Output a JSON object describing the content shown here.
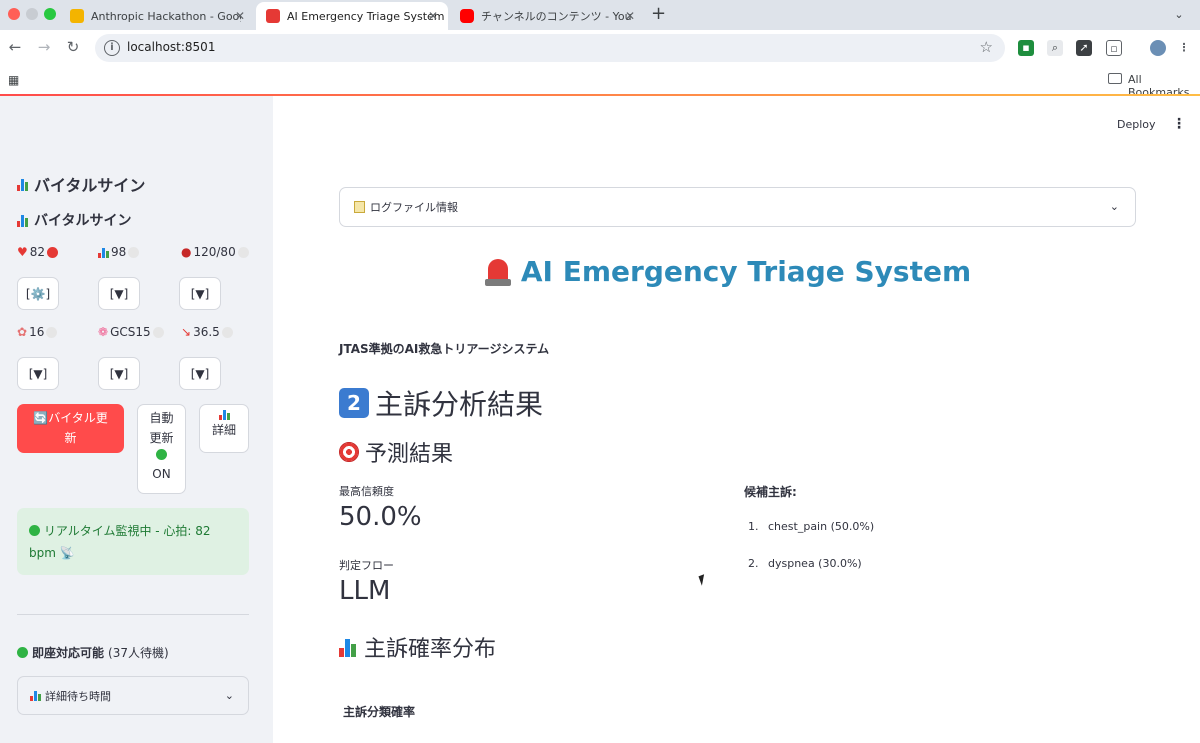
{
  "browser": {
    "tabs": [
      {
        "title": "Anthropic Hackathon - Google",
        "favicon_color": "#f4b400"
      },
      {
        "title": "AI Emergency Triage System",
        "favicon_color": "#e53935"
      },
      {
        "title": "チャンネルのコンテンツ - YouTube",
        "favicon_color": "#ff0000"
      }
    ],
    "close_glyph": "✕",
    "new_tab_glyph": "+",
    "url": "localhost:8501",
    "bookmarks_label": "All Bookmarks"
  },
  "sidebar": {
    "header1": "バイタルサイン",
    "header2": "バイタルサイン",
    "vitals_row1": [
      {
        "icon": "heart-icon",
        "value": "82",
        "status": "red"
      },
      {
        "icon": "chart-icon",
        "value": "98",
        "status": "grey"
      },
      {
        "icon": "blood-drop-icon",
        "value": "120/80",
        "status": "grey"
      }
    ],
    "buttons_row1": [
      "[⚙️]",
      "[▼]",
      "[▼]"
    ],
    "vitals_row2": [
      {
        "icon": "lungs-icon",
        "value": "16",
        "status": "grey"
      },
      {
        "icon": "brain-icon",
        "value": "GCS15",
        "status": "grey"
      },
      {
        "icon": "thermometer-icon",
        "value": "36.5",
        "status": "grey"
      }
    ],
    "buttons_row2": [
      "[▼]",
      "[▼]",
      "[▼]"
    ],
    "update_button": {
      "line1": "バイタル更",
      "line2": "新"
    },
    "auto_button": {
      "line1": "自動",
      "line2": "更新",
      "line3": "ON"
    },
    "detail_button": "詳細",
    "monitor_text_line1": "リアルタイム監視中 - 心拍: 82",
    "monitor_text_line2": "bpm",
    "ready_label": "即座対応可能",
    "ready_count": "(37人待機)",
    "wait_expander": "詳細待ち時間"
  },
  "main": {
    "deploy_label": "Deploy",
    "log_expander": "ログファイル情報",
    "title": "AI Emergency Triage System",
    "subtitle": "JTAS準拠のAI救急トリアージシステム",
    "section_number": "2",
    "section_title": "主訴分析結果",
    "prediction_heading": "予測結果",
    "confidence_label": "最高信頼度",
    "confidence_value": "50.0%",
    "flow_label": "判定フロー",
    "flow_value": "LLM",
    "candidates_label": "候補主訴:",
    "candidates": [
      {
        "num": "1.",
        "text": "chest_pain (50.0%)"
      },
      {
        "num": "2.",
        "text": "dyspnea (30.0%)"
      }
    ],
    "distribution_heading": "主訴確率分布",
    "chart_title": "主訴分類確率"
  },
  "colors": {
    "accent_red": "#ff4b4b",
    "title_blue": "#2d8ab8",
    "sidebar_bg": "#f0f2f6",
    "success_bg": "#dff1e3"
  }
}
